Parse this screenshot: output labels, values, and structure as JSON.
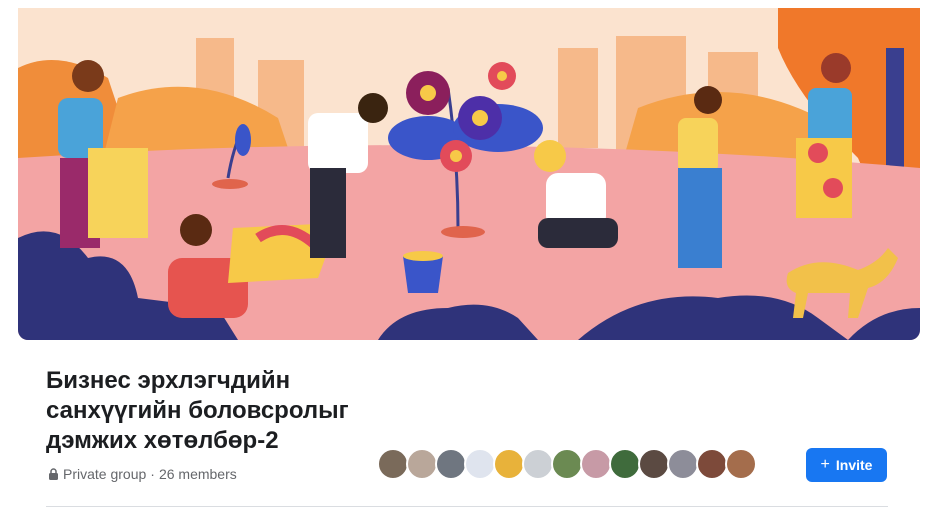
{
  "group": {
    "title_lines": [
      "Бизнес эрхлэгчдийн",
      "санхүүгийн боловсролыг",
      "дэмжих хөтөлбөр-2"
    ],
    "privacy": "Private group",
    "separator": "·",
    "members": "26 members"
  },
  "actions": {
    "invite_label": "Invite",
    "invite_icon": "plus-icon"
  },
  "member_avatars": [
    {
      "color": "#7a6a5a"
    },
    {
      "color": "#b9a79a"
    },
    {
      "color": "#6f7680"
    },
    {
      "color": "#dfe4ee"
    },
    {
      "color": "#e8b23a"
    },
    {
      "color": "#ccd0d5"
    },
    {
      "color": "#6b8a52"
    },
    {
      "color": "#c79aa6"
    },
    {
      "color": "#3f6b3c"
    },
    {
      "color": "#5b4a42"
    },
    {
      "color": "#8d8d99"
    },
    {
      "color": "#7d4a3a"
    },
    {
      "color": "#a46d4c"
    }
  ],
  "colors": {
    "accent": "#1877f2",
    "title": "#1c1e21",
    "muted": "#65676b"
  }
}
